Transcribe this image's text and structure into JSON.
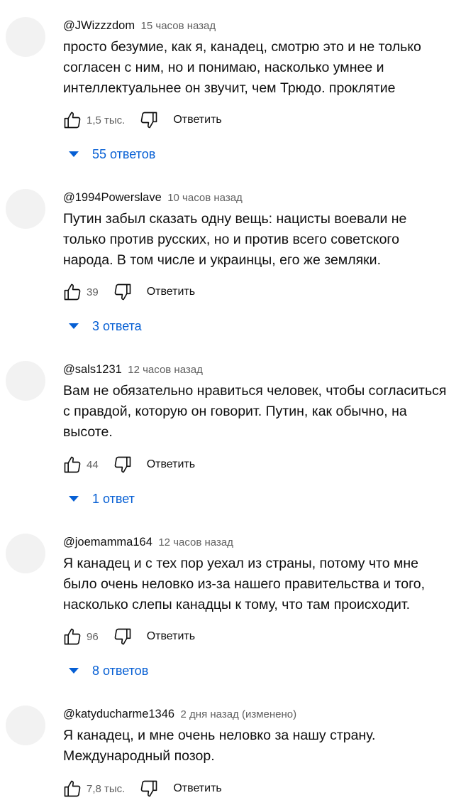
{
  "comments": [
    {
      "author": "@JWizzzdom",
      "time": "15 часов назад",
      "lines": [
        "просто безумие, как я, канадец, смотрю это и не только",
        "согласен с ним, но и понимаю, насколько умнее и",
        "интеллектуальнее он звучит, чем Трюдо. проклятие"
      ],
      "likes": "1,5 тыс.",
      "reply_label": "Ответить",
      "replies": "55 ответов"
    },
    {
      "author": "@1994Powerslave",
      "time": "10 часов назад",
      "lines": [
        "Путин забыл сказать одну вещь: нацисты воевали не",
        "только против русских, но и против всего советского",
        "народа. В том числе и украинцы, его же земляки."
      ],
      "likes": "39",
      "reply_label": "Ответить",
      "replies": "3 ответа"
    },
    {
      "author": "@sals1231",
      "time": "12 часов назад",
      "lines": [
        "Вам не обязательно нравиться человек, чтобы согласиться",
        "с правдой, которую он говорит. Путин, как обычно, на",
        "высоте."
      ],
      "likes": "44",
      "reply_label": "Ответить",
      "replies": "1 ответ"
    },
    {
      "author": "@joemamma164",
      "time": "12 часов назад",
      "lines": [
        "Я канадец и с тех пор уехал из страны, потому что мне",
        "было очень неловко из-за нашего правительства и того,",
        "насколько слепы канадцы к тому, что там происходит."
      ],
      "likes": "96",
      "reply_label": "Ответить",
      "replies": "8 ответов"
    },
    {
      "author": "@katyducharme1346",
      "time": "2 дня назад (изменено)",
      "lines": [
        "Я канадец, и мне очень неловко за нашу страну.",
        "Международный позор."
      ],
      "likes": "7,8 тыс.",
      "reply_label": "Ответить",
      "replies": ""
    }
  ],
  "colors": {
    "text": "#0f0f0f",
    "secondary": "#606060",
    "link": "#065fd4",
    "avatar": "#f2f2f2"
  },
  "icons": [
    "thumb-up-icon",
    "thumb-down-icon",
    "caret-down-icon"
  ]
}
